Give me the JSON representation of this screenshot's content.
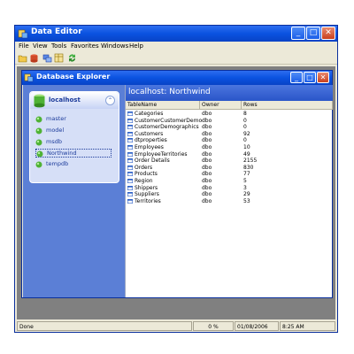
{
  "app": {
    "title": "Data Editor",
    "menu": [
      "File",
      "View",
      "Tools",
      "Favorites",
      "Windows",
      "Help"
    ],
    "toolbar_icons": [
      "open-icon",
      "database-icon",
      "connect-icon",
      "tables-icon",
      "refresh-icon"
    ]
  },
  "child": {
    "title": "Database Explorer"
  },
  "explorer": {
    "server": "localhost",
    "databases": [
      "master",
      "model",
      "msdb",
      "Northwind",
      "tempdb"
    ],
    "selected": "Northwind"
  },
  "content": {
    "title": "localhost: Northwind",
    "columns": [
      "TableName",
      "Owner",
      "Rows"
    ],
    "rows": [
      [
        "Categories",
        "dbo",
        "8"
      ],
      [
        "CustomerCustomerDemo",
        "dbo",
        "0"
      ],
      [
        "CustomerDemographics",
        "dbo",
        "0"
      ],
      [
        "Customers",
        "dbo",
        "92"
      ],
      [
        "dtproperties",
        "dbo",
        "0"
      ],
      [
        "Employees",
        "dbo",
        "10"
      ],
      [
        "EmployeeTerritories",
        "dbo",
        "49"
      ],
      [
        "Order Details",
        "dbo",
        "2155"
      ],
      [
        "Orders",
        "dbo",
        "830"
      ],
      [
        "Products",
        "dbo",
        "77"
      ],
      [
        "Region",
        "dbo",
        "5"
      ],
      [
        "Shippers",
        "dbo",
        "3"
      ],
      [
        "Suppliers",
        "dbo",
        "29"
      ],
      [
        "Territories",
        "dbo",
        "53"
      ]
    ]
  },
  "status": {
    "message": "Done",
    "progress": "0 %",
    "date": "01/08/2006",
    "time": "8:25 AM"
  },
  "colors": {
    "titlebar": "#0a52e0",
    "explorer_bg": "#5b7fd6",
    "link": "#1c3b9b"
  }
}
